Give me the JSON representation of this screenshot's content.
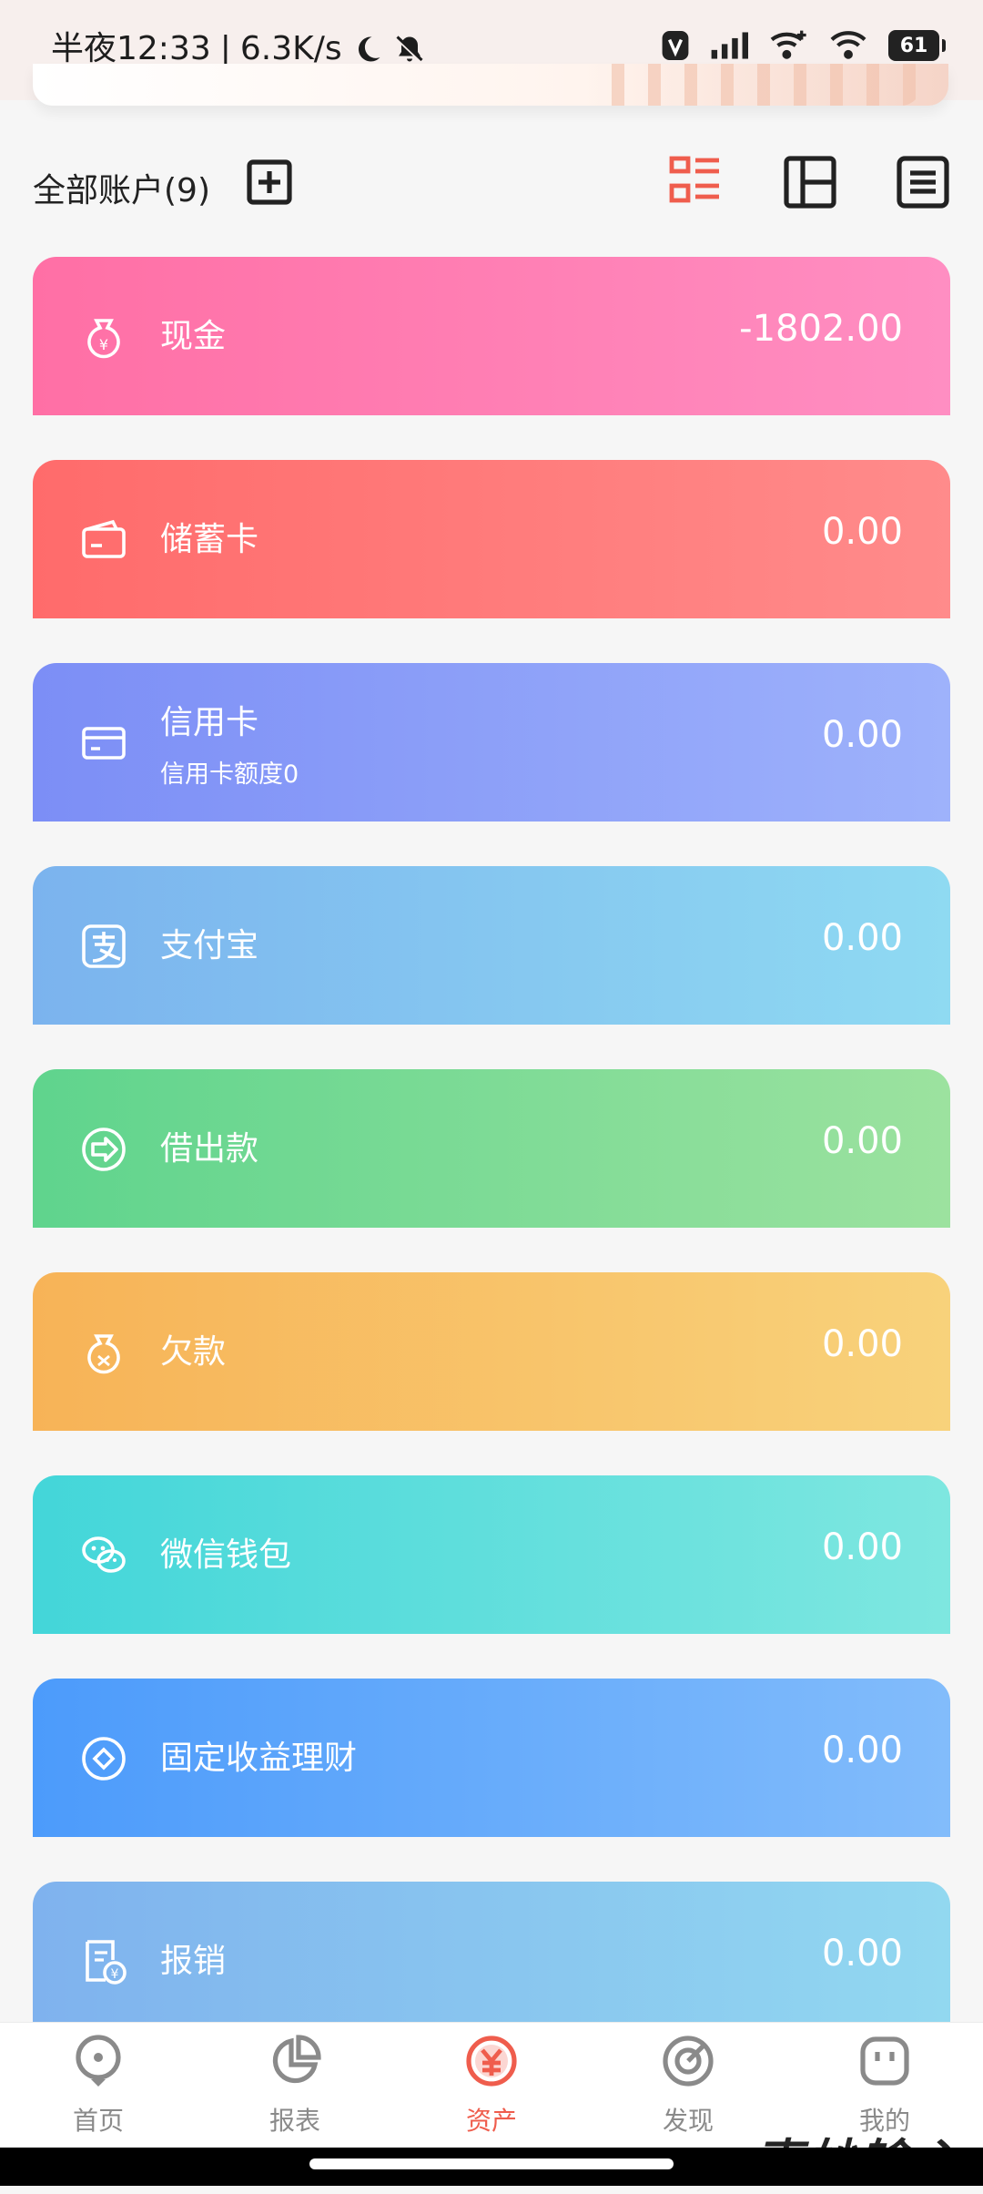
{
  "status": {
    "time": "半夜12:33",
    "separator": "|",
    "speed": "6.3K/s",
    "battery": "61"
  },
  "header": {
    "title": "全部账户(9)",
    "accent_color": "#ef5d4d"
  },
  "accounts": [
    {
      "name": "现金",
      "sub": "",
      "amount": "-1802.00",
      "icon": "money-bag-yen-icon",
      "color_from": "#ff6fa5",
      "color_to": "#ff8ec2"
    },
    {
      "name": "储蓄卡",
      "sub": "",
      "amount": "0.00",
      "icon": "wallet-icon",
      "color_from": "#ff6b6b",
      "color_to": "#ff8b8b"
    },
    {
      "name": "信用卡",
      "sub": "信用卡额度0",
      "amount": "0.00",
      "icon": "credit-card-icon",
      "color_from": "#7c8ef6",
      "color_to": "#9eb2fb"
    },
    {
      "name": "支付宝",
      "sub": "",
      "amount": "0.00",
      "icon": "alipay-icon",
      "color_from": "#7bb3ee",
      "color_to": "#8fdaf2"
    },
    {
      "name": "借出款",
      "sub": "",
      "amount": "0.00",
      "icon": "lend-arrow-icon",
      "color_from": "#5fd48d",
      "color_to": "#9ce29f"
    },
    {
      "name": "欠款",
      "sub": "",
      "amount": "0.00",
      "icon": "debt-bag-icon",
      "color_from": "#f7b357",
      "color_to": "#f8d27b"
    },
    {
      "name": "微信钱包",
      "sub": "",
      "amount": "0.00",
      "icon": "wechat-icon",
      "color_from": "#43d6d9",
      "color_to": "#7ee7e0"
    },
    {
      "name": "固定收益理财",
      "sub": "",
      "amount": "0.00",
      "icon": "coin-diamond-icon",
      "color_from": "#4c9bfb",
      "color_to": "#82bcfb"
    },
    {
      "name": "报销",
      "sub": "",
      "amount": "0.00",
      "icon": "reimbursement-icon",
      "color_from": "#7fb2ee",
      "color_to": "#92d8f0"
    }
  ],
  "tabs": [
    {
      "label": "首页",
      "icon": "home-pin-icon",
      "active": false
    },
    {
      "label": "报表",
      "icon": "pie-chart-icon",
      "active": false
    },
    {
      "label": "资产",
      "icon": "yen-coin-icon",
      "active": true
    },
    {
      "label": "发现",
      "icon": "discover-icon",
      "active": false
    },
    {
      "label": "我的",
      "icon": "profile-icon",
      "active": false
    }
  ],
  "watermark": "索妙输心"
}
